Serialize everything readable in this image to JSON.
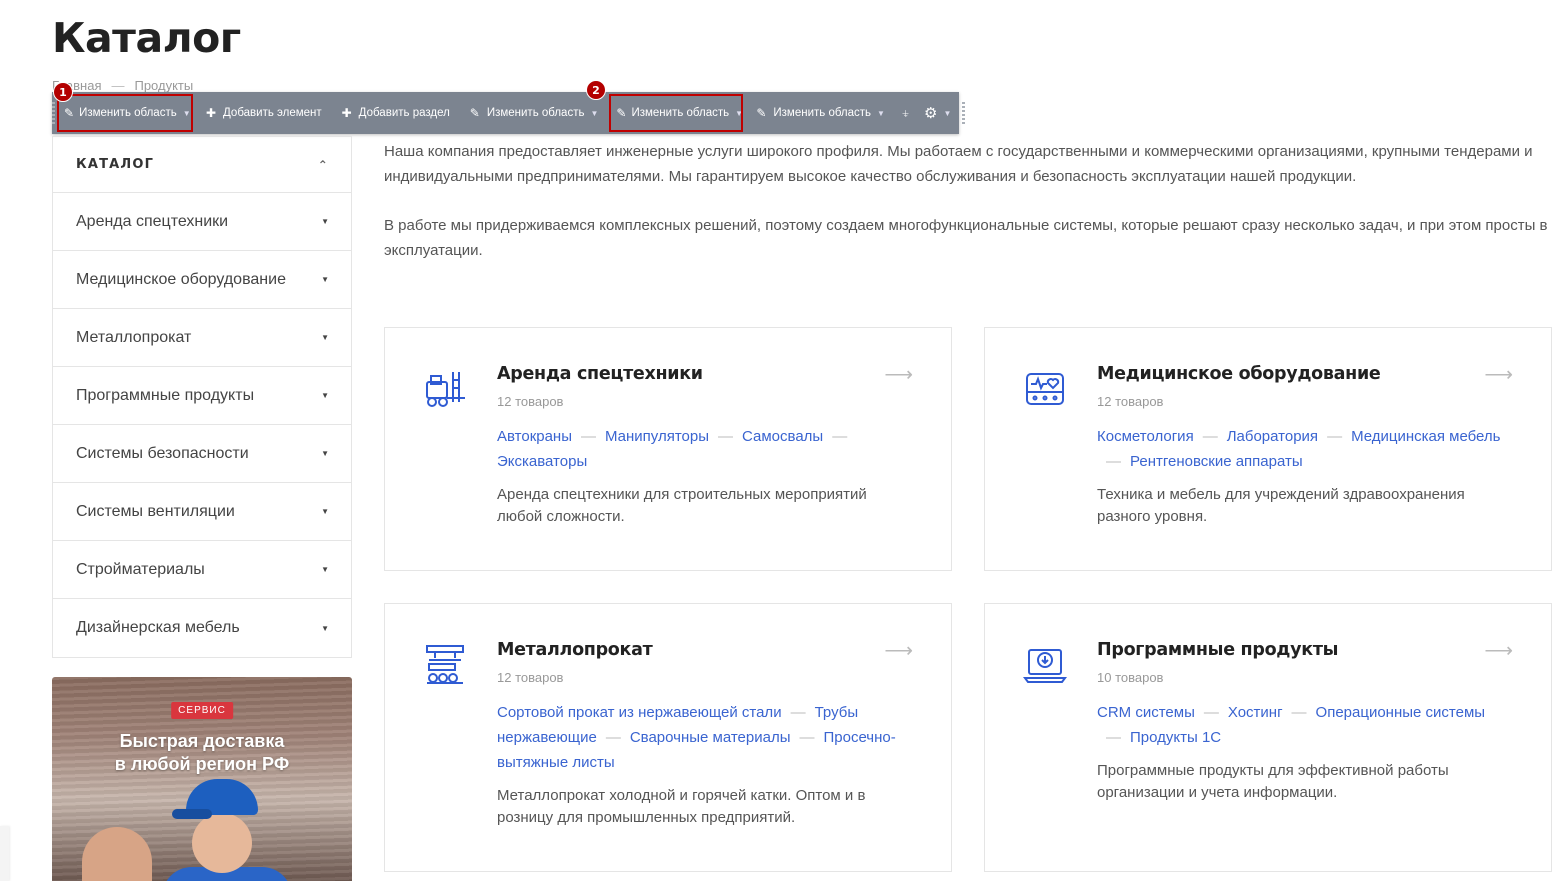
{
  "page": {
    "title": "Каталог"
  },
  "breadcrumb": {
    "home": "Главная",
    "separator": "—",
    "current": "Продукты"
  },
  "toolbar": {
    "buttons": [
      {
        "label": "Изменить область",
        "icon": "pencil-icon",
        "dropdown": true
      },
      {
        "label": "Добавить элемент",
        "icon": "plus-icon",
        "dropdown": false
      },
      {
        "label": "Добавить раздел",
        "icon": "plus-icon",
        "dropdown": false
      },
      {
        "label": "Изменить область",
        "icon": "pencil-icon",
        "dropdown": true
      },
      {
        "label": "Изменить область",
        "icon": "pencil-icon",
        "dropdown": true
      },
      {
        "label": "Изменить область",
        "icon": "pencil-icon",
        "dropdown": true
      }
    ],
    "markers": [
      "1",
      "2"
    ],
    "highlight_color": "#c00000"
  },
  "sidebar": {
    "heading": "КАТАЛОГ",
    "items": [
      {
        "label": "Аренда спецтехники"
      },
      {
        "label": "Медицинское оборудование"
      },
      {
        "label": "Металлопрокат"
      },
      {
        "label": "Программные продукты"
      },
      {
        "label": "Системы безопасности"
      },
      {
        "label": "Системы вентиляции"
      },
      {
        "label": "Стройматериалы"
      },
      {
        "label": "Дизайнерская мебель"
      }
    ]
  },
  "promo": {
    "tag": "СЕРВИС",
    "title_line1": "Быстрая доставка",
    "title_line2": "в любой регион РФ"
  },
  "intro": {
    "p1": "Наша компания предоставляет инженерные услуги широкого профиля. Мы работаем с государственными и коммерческими организациями, крупными тендерами и индивидуальными предпринимателями. Мы гарантируем высокое качество обслуживания и безопасность эксплуатации нашей продукции.",
    "p2": "В работе мы придерживаемся комплексных решений, поэтому создаем многофункциональные системы, которые решают сразу несколько задач, и при этом просты в эксплуатации."
  },
  "cards": [
    {
      "title": "Аренда спецтехники",
      "count": "12 товаров",
      "icon": "forklift-icon",
      "links": [
        "Автокраны",
        "Манипуляторы",
        "Самосвалы",
        "Экскаваторы"
      ],
      "desc": "Аренда спецтехники для строительных мероприятий любой сложности."
    },
    {
      "title": "Медицинское оборудование",
      "count": "12 товаров",
      "icon": "medical-device-icon",
      "links": [
        "Косметология",
        "Лаборатория",
        "Медицинская мебель",
        "Рентгеновские аппараты"
      ],
      "desc": "Техника и мебель для учреждений здравоохранения разного уровня."
    },
    {
      "title": "Металлопрокат",
      "count": "12 товаров",
      "icon": "metal-pipes-icon",
      "links": [
        "Сортовой прокат из нержавеющей стали",
        "Трубы нержавеющие",
        "Сварочные материалы",
        "Просечно-вытяжные листы"
      ],
      "desc": "Металлопрокат холодной и горячей катки. Оптом и в розницу для промышленных предприятий."
    },
    {
      "title": "Программные продукты",
      "count": "10 товаров",
      "icon": "laptop-download-icon",
      "links": [
        "CRM системы",
        "Хостинг",
        "Операционные системы",
        "Продукты 1С"
      ],
      "desc": "Программные продукты для эффективной работы организации и учета информации."
    }
  ],
  "colors": {
    "accent": "#3a64d0",
    "toolbar": "#7c8490",
    "promo_tag": "#d9363e"
  }
}
